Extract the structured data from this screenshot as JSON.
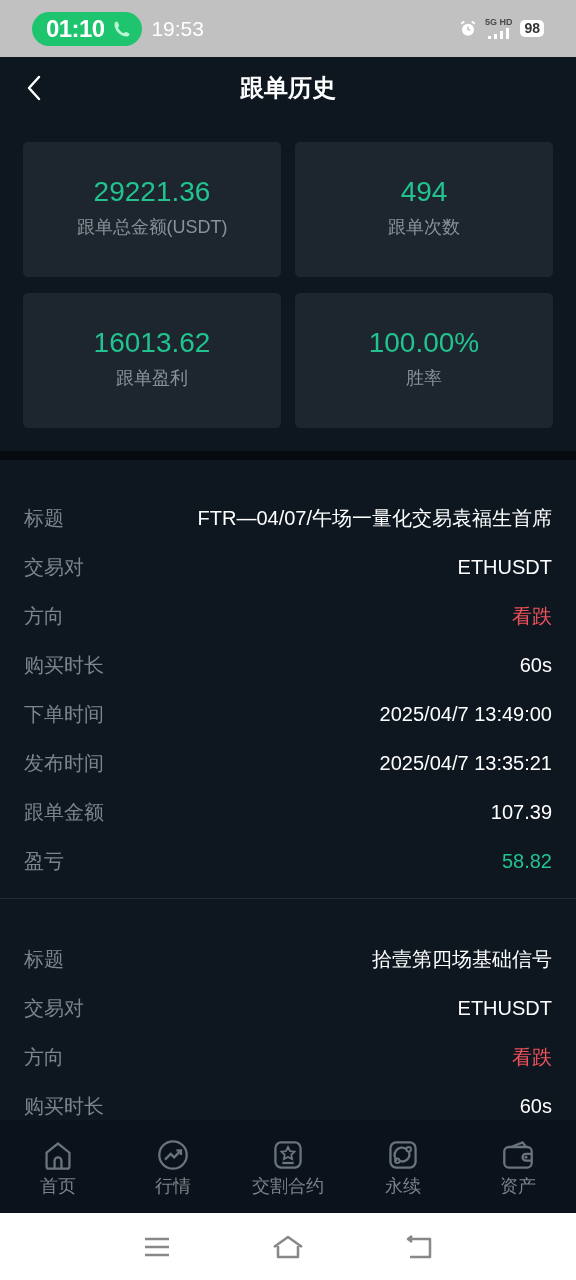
{
  "status_bar": {
    "call_timer": "01:10",
    "time": "19:53",
    "network": "5G HD",
    "battery": "98"
  },
  "header": {
    "title": "跟单历史"
  },
  "stats": [
    {
      "value": "29221.36",
      "label": "跟单总金额(USDT)"
    },
    {
      "value": "494",
      "label": "跟单次数"
    },
    {
      "value": "16013.62",
      "label": "跟单盈利"
    },
    {
      "value": "100.00%",
      "label": "胜率"
    }
  ],
  "records": [
    {
      "rows": [
        {
          "label": "标题",
          "value": "FTR—04/07/午场一量化交易袁福生首席",
          "kind": "plain"
        },
        {
          "label": "交易对",
          "value": "ETHUSDT",
          "kind": "plain"
        },
        {
          "label": "方向",
          "value": "看跌",
          "kind": "down"
        },
        {
          "label": "购买时长",
          "value": "60s",
          "kind": "plain"
        },
        {
          "label": "下单时间",
          "value": "2025/04/7 13:49:00",
          "kind": "plain"
        },
        {
          "label": "发布时间",
          "value": "2025/04/7 13:35:21",
          "kind": "plain"
        },
        {
          "label": "跟单金额",
          "value": "107.39",
          "kind": "plain"
        },
        {
          "label": "盈亏",
          "value": "58.82",
          "kind": "up"
        }
      ]
    },
    {
      "rows": [
        {
          "label": "标题",
          "value": "拾壹第四场基础信号",
          "kind": "plain"
        },
        {
          "label": "交易对",
          "value": "ETHUSDT",
          "kind": "plain"
        },
        {
          "label": "方向",
          "value": "看跌",
          "kind": "down"
        },
        {
          "label": "购买时长",
          "value": "60s",
          "kind": "plain"
        }
      ]
    }
  ],
  "tab_bar": [
    {
      "label": "首页",
      "kind": "home"
    },
    {
      "label": "行情",
      "kind": "trend"
    },
    {
      "label": "交割合约",
      "kind": "star"
    },
    {
      "label": "永续",
      "kind": "orbit"
    },
    {
      "label": "资产",
      "kind": "wallet"
    }
  ]
}
